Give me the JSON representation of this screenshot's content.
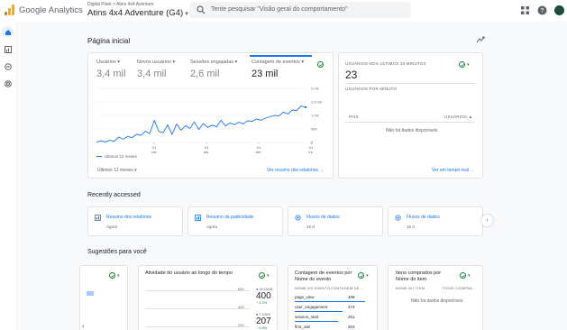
{
  "header": {
    "brand": "Google Analytics",
    "breadcrumb": "Digital Plant > Atins 4x4 Aventure",
    "property": "Atins 4x4 Adventure (G4)",
    "search_placeholder": "Tente pesquisar \"Visão geral do comportamento\""
  },
  "page": {
    "title": "Página inicial"
  },
  "metrics": [
    {
      "label": "Usuários",
      "value": "3,4 mil"
    },
    {
      "label": "Novos usuários",
      "value": "3,4 mil"
    },
    {
      "label": "Sessões engajadas",
      "value": "2,6 mil"
    },
    {
      "label": "Contagem de eventos",
      "value": "23 mil"
    }
  ],
  "main_chart": {
    "legend": "Últimos 12 meses",
    "range_label": "Últimos 12 meses",
    "link": "Ver resumo dos relatórios",
    "y_ticks": [
      "2 mil",
      "1,5 mil",
      "1 mil",
      "500",
      "0"
    ],
    "x_ticks": [
      {
        "day": "01",
        "month": "out."
      },
      {
        "day": "01",
        "month": "jan."
      },
      {
        "day": "01",
        "month": "abr."
      },
      {
        "day": "01",
        "month": "jul."
      }
    ]
  },
  "chart_data": {
    "type": "line",
    "series": [
      {
        "name": "Últimos 12 meses",
        "values": [
          10,
          60,
          20,
          80,
          40,
          200,
          120,
          220,
          180,
          300,
          260,
          420,
          330,
          820,
          410,
          360,
          650,
          300,
          680,
          450,
          620,
          520,
          760,
          480,
          700,
          560,
          640,
          580,
          820,
          610,
          720,
          660,
          750,
          690,
          800,
          780,
          870,
          820,
          900,
          950,
          1000,
          980,
          1120,
          1050,
          1200,
          1180,
          1350,
          1300
        ]
      }
    ],
    "ylim": [
      0,
      2000
    ],
    "yticks": [
      "0",
      "500",
      "1 mil",
      "1,5 mil",
      "2 mil"
    ],
    "grid": true,
    "legend": "bottom-left"
  },
  "realtime": {
    "title": "USUÁRIOS NOS ÚLTIMOS 30 MINUTOS",
    "value": "23",
    "per_minute": "USUÁRIOS POR MINUTO",
    "col_country": "PAÍS",
    "col_users": "USUÁRIOS",
    "no_data": "Não há dados disponíveis",
    "link": "Ver em tempo real"
  },
  "recent": {
    "title": "Recently accessed",
    "items": [
      {
        "title": "Resumo dos relatórios",
        "sub": "Agora"
      },
      {
        "title": "Resumo da publicidade",
        "sub": "Agora"
      },
      {
        "title": "Fluxos de dados",
        "sub": "16 ⁠d"
      },
      {
        "title": "Fluxos de dados",
        "sub": "16 ⁠d"
      }
    ]
  },
  "suggestions": {
    "title": "Sugestões para você",
    "activity": {
      "title": "Atividade do usuário ao longo do tempo",
      "y_ticks": [
        "600",
        "400",
        "200"
      ],
      "l1_label": "30 DIAS",
      "l1_value": "400",
      "l1_delta": "3,1%",
      "l2_label": "7 DIAS",
      "l2_value": "207",
      "l2_delta": "4,9%"
    },
    "events": {
      "title1": "Contagem de eventos por",
      "title2": "Nome do evento",
      "col1": "NOME DO EVENTO",
      "col2": "CONTAGEM DE ...",
      "rows": [
        {
          "name": "page_view",
          "value": "408"
        },
        {
          "name": "user_engagement",
          "value": "274"
        },
        {
          "name": "session_start",
          "value": "251"
        },
        {
          "name": "first_visit",
          "value": "203"
        }
      ]
    },
    "items": {
      "title1": "Itens comprados por",
      "title2": "Nome do item",
      "col1": "NOME DO ITEM",
      "col2": "ITENS COMPRA...",
      "no_data": "Não há dados disponíveis"
    }
  },
  "colors": {
    "accent": "#1a73e8",
    "success": "#188038"
  }
}
